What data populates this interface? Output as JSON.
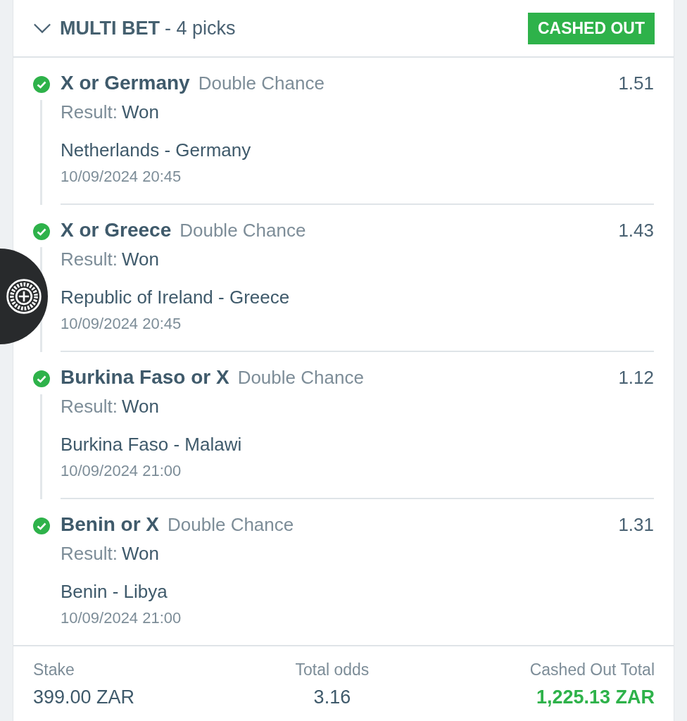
{
  "header": {
    "expanded": true,
    "title": "MULTI BET",
    "subtitle": "- 4 picks",
    "status": "CASHED OUT"
  },
  "picks": [
    {
      "won": true,
      "selection": "X or Germany",
      "market": "Double Chance",
      "odds": "1.51",
      "result_label": "Result:",
      "result": "Won",
      "match": "Netherlands - Germany",
      "datetime": "10/09/2024 20:45"
    },
    {
      "won": true,
      "selection": "X or Greece",
      "market": "Double Chance",
      "odds": "1.43",
      "result_label": "Result:",
      "result": "Won",
      "match": "Republic of Ireland - Greece",
      "datetime": "10/09/2024 20:45"
    },
    {
      "won": true,
      "selection": "Burkina Faso or X",
      "market": "Double Chance",
      "odds": "1.12",
      "result_label": "Result:",
      "result": "Won",
      "match": "Burkina Faso - Malawi",
      "datetime": "10/09/2024 21:00"
    },
    {
      "won": true,
      "selection": "Benin or X",
      "market": "Double Chance",
      "odds": "1.31",
      "result_label": "Result:",
      "result": "Won",
      "match": "Benin - Libya",
      "datetime": "10/09/2024 21:00"
    }
  ],
  "summary": [
    {
      "label": "Stake",
      "value": "399.00 ZAR",
      "highlight": false
    },
    {
      "label": "Total odds",
      "value": "3.16",
      "highlight": false
    },
    {
      "label": "Cashed Out Total",
      "value": "1,225.13 ZAR",
      "highlight": true
    }
  ]
}
